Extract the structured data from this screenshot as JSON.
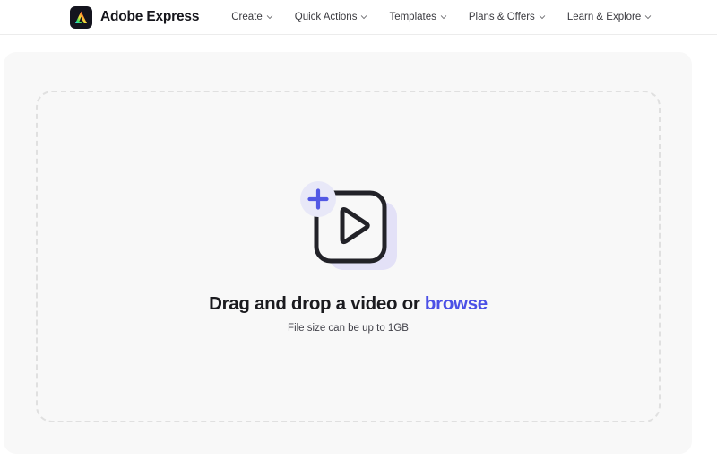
{
  "header": {
    "brand": {
      "logo_icon": "adobe-express-logo-icon",
      "name": "Adobe Express"
    },
    "nav": [
      {
        "label": "Create",
        "icon": "chevron-down-icon"
      },
      {
        "label": "Quick Actions",
        "icon": "chevron-down-icon"
      },
      {
        "label": "Templates",
        "icon": "chevron-down-icon"
      },
      {
        "label": "Plans & Offers",
        "icon": "chevron-down-icon"
      },
      {
        "label": "Learn & Explore",
        "icon": "chevron-down-icon"
      }
    ]
  },
  "dropzone": {
    "icon": "add-video-icon",
    "title_prefix": "Drag and drop a video or ",
    "browse_label": "browse",
    "subtitle": "File size can be up to 1GB"
  },
  "colors": {
    "accent": "#4b50e6",
    "card_background": "#f8f8f8",
    "dashed_border": "#e0e0e0",
    "icon_dark": "#222228",
    "icon_lavender": "#e3e1f7",
    "plus_circle": "#e8e8f8",
    "text_primary": "#1b1b1f"
  }
}
